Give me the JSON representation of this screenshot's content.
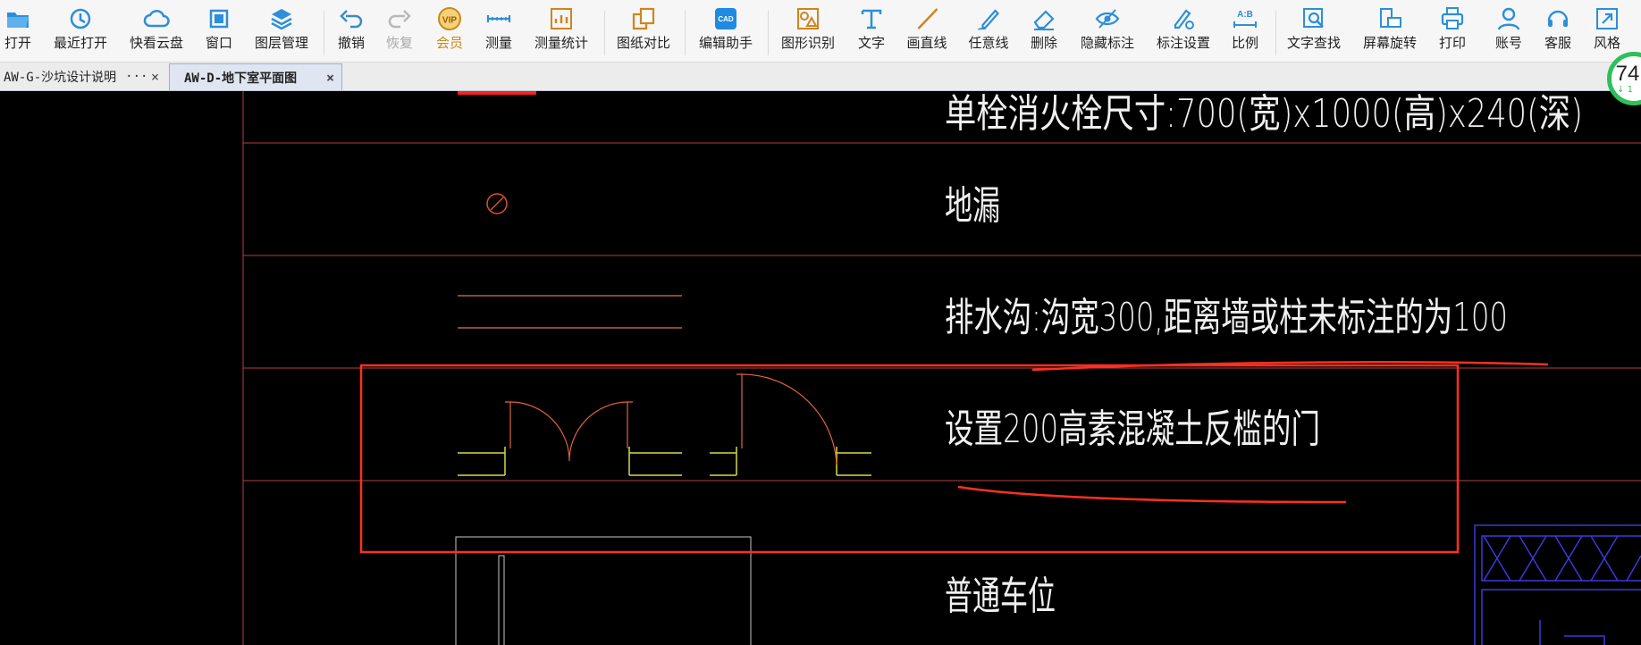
{
  "toolbar": {
    "items": [
      {
        "label": "打开",
        "icon": "open-folder-icon"
      },
      {
        "label": "最近打开",
        "icon": "recent-history-icon"
      },
      {
        "label": "快看云盘",
        "icon": "cloud-drive-icon"
      },
      {
        "label": "窗口",
        "icon": "window-icon"
      },
      {
        "label": "图层管理",
        "icon": "layers-icon"
      },
      {
        "label": "撤销",
        "icon": "undo-icon"
      },
      {
        "label": "恢复",
        "icon": "redo-icon"
      },
      {
        "label": "会员",
        "icon": "vip-badge-icon",
        "badge": "VIP"
      },
      {
        "label": "测量",
        "icon": "ruler-icon"
      },
      {
        "label": "测量统计",
        "icon": "measure-stats-icon"
      },
      {
        "label": "图纸对比",
        "icon": "compare-drawings-icon"
      },
      {
        "label": "编辑助手",
        "icon": "edit-assistant-icon",
        "badge": "CAD"
      },
      {
        "label": "图形识别",
        "icon": "shape-recognition-icon"
      },
      {
        "label": "文字",
        "icon": "text-icon"
      },
      {
        "label": "画直线",
        "icon": "line-icon"
      },
      {
        "label": "任意线",
        "icon": "freehand-pen-icon"
      },
      {
        "label": "删除",
        "icon": "eraser-icon"
      },
      {
        "label": "隐藏标注",
        "icon": "hide-eye-icon"
      },
      {
        "label": "标注设置",
        "icon": "annotation-settings-icon"
      },
      {
        "label": "比例",
        "icon": "scale-icon",
        "badge": "A:B"
      },
      {
        "label": "文字查找",
        "icon": "text-search-icon"
      },
      {
        "label": "屏幕旋转",
        "icon": "screen-rotate-icon"
      },
      {
        "label": "打印",
        "icon": "printer-icon"
      },
      {
        "label": "账号",
        "icon": "account-user-icon"
      },
      {
        "label": "客服",
        "icon": "headset-icon"
      },
      {
        "label": "风格",
        "icon": "style-expand-icon"
      }
    ]
  },
  "tabs": [
    {
      "label": "AW-G-沙坑设计说明",
      "more": "···",
      "close": "×",
      "active": false
    },
    {
      "label": "AW-D-地下室平面图",
      "close": "×",
      "active": true
    }
  ],
  "drawing": {
    "legend_texts": [
      "单栓消火栓尺寸:700(宽)x1000(高)x240(深)",
      "地漏",
      "排水沟:沟宽300,距离墙或柱未标注的为100",
      "设置200高素混凝土反槛的门",
      "普通车位"
    ]
  },
  "gauge": {
    "value": "74",
    "sub": "↓ 1"
  },
  "colors": {
    "cad_background": "#000000",
    "grid_line": "#b44040",
    "red_markup": "#ff3020",
    "text_white": "#f0f0f0",
    "door_yellow": "#d8d84a",
    "door_red": "#e0643c",
    "parking_blue": "#3a3ad8"
  }
}
